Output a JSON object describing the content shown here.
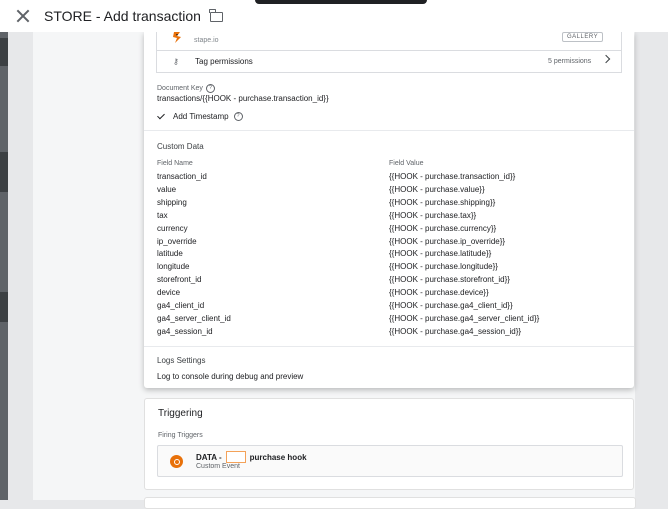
{
  "window": {
    "title": "STORE - Add transaction"
  },
  "template": {
    "name": "stape.io",
    "gallery_label": "GALLERY"
  },
  "permissions": {
    "label": "Tag permissions",
    "count": "5 permissions"
  },
  "document_key": {
    "label": "Document Key",
    "value": "transactions/{{HOOK - purchase.transaction_id}}"
  },
  "timestamp": {
    "label": "Add Timestamp"
  },
  "custom_data": {
    "title": "Custom Data",
    "col_name": "Field Name",
    "col_value": "Field Value",
    "rows": [
      {
        "name": "transaction_id",
        "value": "{{HOOK - purchase.transaction_id}}"
      },
      {
        "name": "value",
        "value": "{{HOOK - purchase.value}}"
      },
      {
        "name": "shipping",
        "value": "{{HOOK - purchase.shipping}}"
      },
      {
        "name": "tax",
        "value": "{{HOOK - purchase.tax}}"
      },
      {
        "name": "currency",
        "value": "{{HOOK - purchase.currency}}"
      },
      {
        "name": "ip_override",
        "value": "{{HOOK - purchase.ip_override}}"
      },
      {
        "name": "latitude",
        "value": "{{HOOK - purchase.latitude}}"
      },
      {
        "name": "longitude",
        "value": "{{HOOK - purchase.longitude}}"
      },
      {
        "name": "storefront_id",
        "value": "{{HOOK - purchase.storefront_id}}"
      },
      {
        "name": "device",
        "value": "{{HOOK - purchase.device}}"
      },
      {
        "name": "ga4_client_id",
        "value": "{{HOOK - purchase.ga4_client_id}}"
      },
      {
        "name": "ga4_server_client_id",
        "value": "{{HOOK - purchase.ga4_server_client_id}}"
      },
      {
        "name": "ga4_session_id",
        "value": "{{HOOK - purchase.ga4_session_id}}"
      }
    ]
  },
  "logs": {
    "title": "Logs Settings",
    "text": "Log to console during debug and preview"
  },
  "triggering": {
    "title": "Triggering",
    "firing_label": "Firing Triggers",
    "trigger_prefix": "DATA -",
    "trigger_suffix": "purchase hook",
    "trigger_type": "Custom Event"
  },
  "colors": {
    "accent_orange": "#e8710a"
  }
}
